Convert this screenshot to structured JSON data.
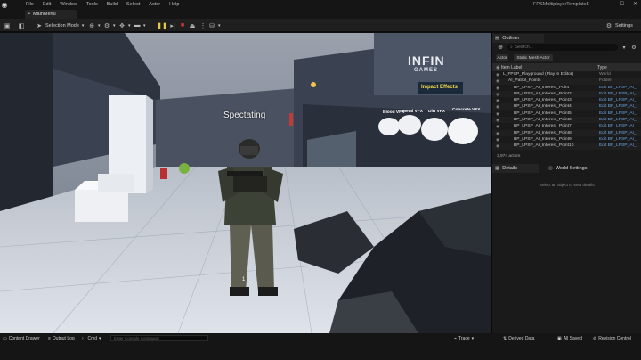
{
  "menu": [
    "File",
    "Edit",
    "Window",
    "Tools",
    "Build",
    "Select",
    "Actor",
    "Help"
  ],
  "project_name": "FPSMultiplayerTemplate5",
  "window_controls": [
    "—",
    "☐",
    "✕"
  ],
  "level_tab": "MainMenu",
  "toolbar": {
    "mode": "Selection Mode",
    "settings": "Settings"
  },
  "viewport": {
    "spectating": "Spectating",
    "crosshair": "1",
    "impact_effects": "Impact Effects",
    "wall_brand_1": "INFIN",
    "wall_brand_2": "GAMES",
    "vfx_labels": [
      "Blood VFX",
      "Metal VFX",
      "Dirt VFX",
      "Concrete VFX"
    ]
  },
  "outliner": {
    "tab": "Outliner",
    "search_placeholder": "Search...",
    "filters": [
      "Actor",
      "Static Mesh Actor"
    ],
    "col_label": "Item Label",
    "col_type": "Type",
    "rows": [
      {
        "label": "L_FPSP_Playground (Play in Editor)",
        "type": "World",
        "indent": 0,
        "link": false
      },
      {
        "label": "AI_Patrol_Points",
        "type": "Folder",
        "indent": 1,
        "link": false
      },
      {
        "label": "BP_LPSP_AI_Interest_Point",
        "type": "Edit BP_LPSP_AI_I",
        "indent": 2,
        "link": true
      },
      {
        "label": "BP_LPSP_AI_Interest_Point2",
        "type": "Edit BP_LPSP_AI_I",
        "indent": 2,
        "link": true
      },
      {
        "label": "BP_LPSP_AI_Interest_Point3",
        "type": "Edit BP_LPSP_AI_I",
        "indent": 2,
        "link": true
      },
      {
        "label": "BP_LPSP_AI_Interest_Point4",
        "type": "Edit BP_LPSP_AI_I",
        "indent": 2,
        "link": true
      },
      {
        "label": "BP_LPSP_AI_Interest_Point5",
        "type": "Edit BP_LPSP_AI_I",
        "indent": 2,
        "link": true
      },
      {
        "label": "BP_LPSP_AI_Interest_Point6",
        "type": "Edit BP_LPSP_AI_I",
        "indent": 2,
        "link": true
      },
      {
        "label": "BP_LPSP_AI_Interest_Point7",
        "type": "Edit BP_LPSP_AI_I",
        "indent": 2,
        "link": true
      },
      {
        "label": "BP_LPSP_AI_Interest_Point8",
        "type": "Edit BP_LPSP_AI_I",
        "indent": 2,
        "link": true
      },
      {
        "label": "BP_LPSP_AI_Interest_Point9",
        "type": "Edit BP_LPSP_AI_I",
        "indent": 2,
        "link": true
      },
      {
        "label": "BP_LPSP_AI_Interest_Point10",
        "type": "Edit BP_LPSP_AI_I",
        "indent": 2,
        "link": true
      }
    ],
    "actors_count": "3,974 actors"
  },
  "details": {
    "tab": "Details",
    "world_settings_tab": "World Settings",
    "empty_text": "Select an object to view details."
  },
  "statusbar": {
    "content_drawer": "Content Drawer",
    "output_log": "Output Log",
    "cmd": "Cmd",
    "console_placeholder": "Enter Console Command",
    "trace": "Trace",
    "derived_data": "Derived Data",
    "all_saved": "All Saved",
    "revision_control": "Revision Control"
  },
  "colors": {
    "accent_play": "#3fb83f",
    "stop": "#d23a3a",
    "link": "#6aa3e0",
    "impact_text": "#f2d84b"
  }
}
